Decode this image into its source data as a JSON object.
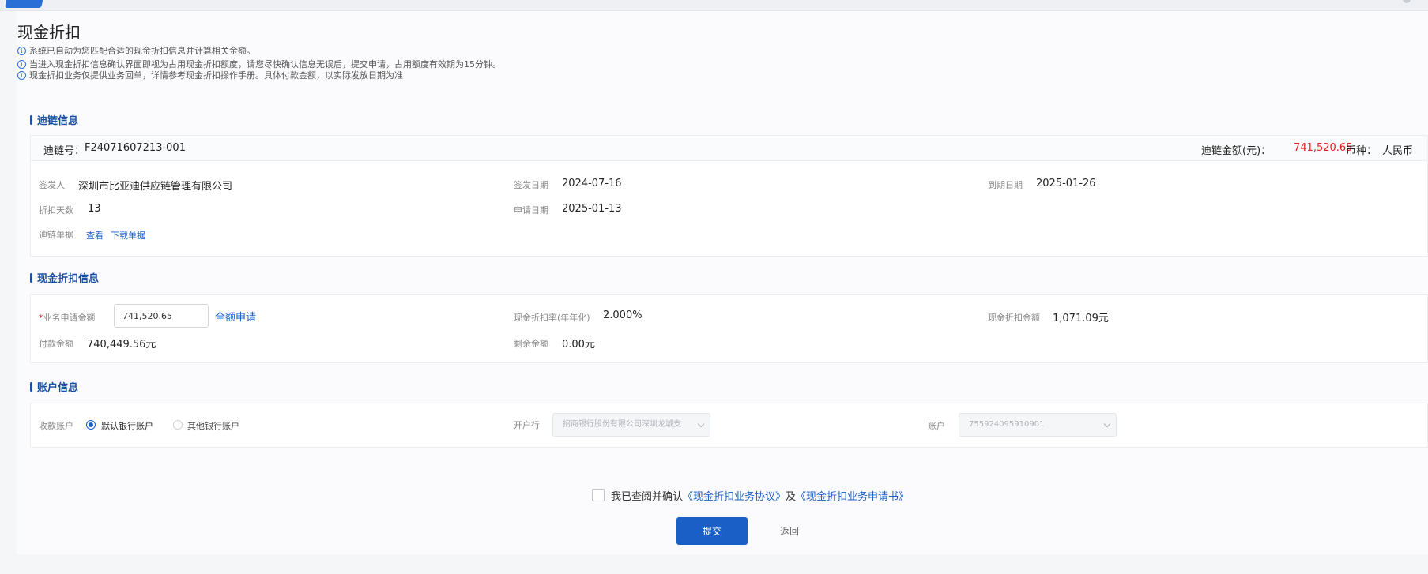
{
  "page": {
    "title": "现金折扣"
  },
  "notices": [
    "系统已自动为您匹配合适的现金折扣信息并计算相关金额。",
    "当进入现金折扣信息确认界面即视为占用现金折扣额度，请您尽快确认信息无误后，提交申请，占用额度有效期为15分钟。",
    "现金折扣业务仅提供业务回单，详情参考现金折扣操作手册。具体付款金额，以实际发放日期为准"
  ],
  "chain": {
    "section_title": "迪链信息",
    "chain_no_label": "迪链号：",
    "chain_no": "F24071607213-001",
    "amount_label": "迪链金额(元)：",
    "amount": "741,520.65",
    "currency_label": "币种：",
    "currency": "人民币",
    "issuer_label": "签发人",
    "issuer": "深圳市比亚迪供应链管理有限公司",
    "sign_date_label": "签发日期",
    "sign_date": "2024-07-16",
    "due_date_label": "到期日期",
    "due_date": "2025-01-26",
    "discount_days_label": "折扣天数",
    "discount_days": "13",
    "apply_date_label": "申请日期",
    "apply_date": "2025-01-13",
    "doc_label": "迪链单据",
    "view_link": "查看",
    "download_link": "下载单据"
  },
  "discount": {
    "section_title": "现金折扣信息",
    "required_mark": "*",
    "apply_amount_label": "业务申请金额",
    "apply_amount_value": "741,520.65",
    "full_apply_link": "全额申请",
    "rate_label": "现金折扣率(年年化)",
    "rate": "2.000%",
    "discount_amount_label": "现金折扣金额",
    "discount_amount": "1,071.09元",
    "pay_amount_label": "付款金额",
    "pay_amount": "740,449.56元",
    "remain_label": "剩余金额",
    "remain": "0.00元"
  },
  "account": {
    "section_title": "账户信息",
    "receive_label": "收款账户",
    "option_default": "默认银行账户",
    "option_other": "其他银行账户",
    "bank_label": "开户行",
    "bank_value": "招商银行股份有限公司深圳龙城支",
    "account_label": "账户",
    "account_value": "755924095910901"
  },
  "agreement": {
    "prefix": "我已查阅并确认",
    "doc1": "《现金折扣业务协议》",
    "and": "及",
    "doc2": "《现金折扣业务申请书》"
  },
  "actions": {
    "submit": "提交",
    "back": "返回"
  },
  "colors": {
    "primary": "#1a5fc6",
    "amount_red": "#e02020"
  }
}
